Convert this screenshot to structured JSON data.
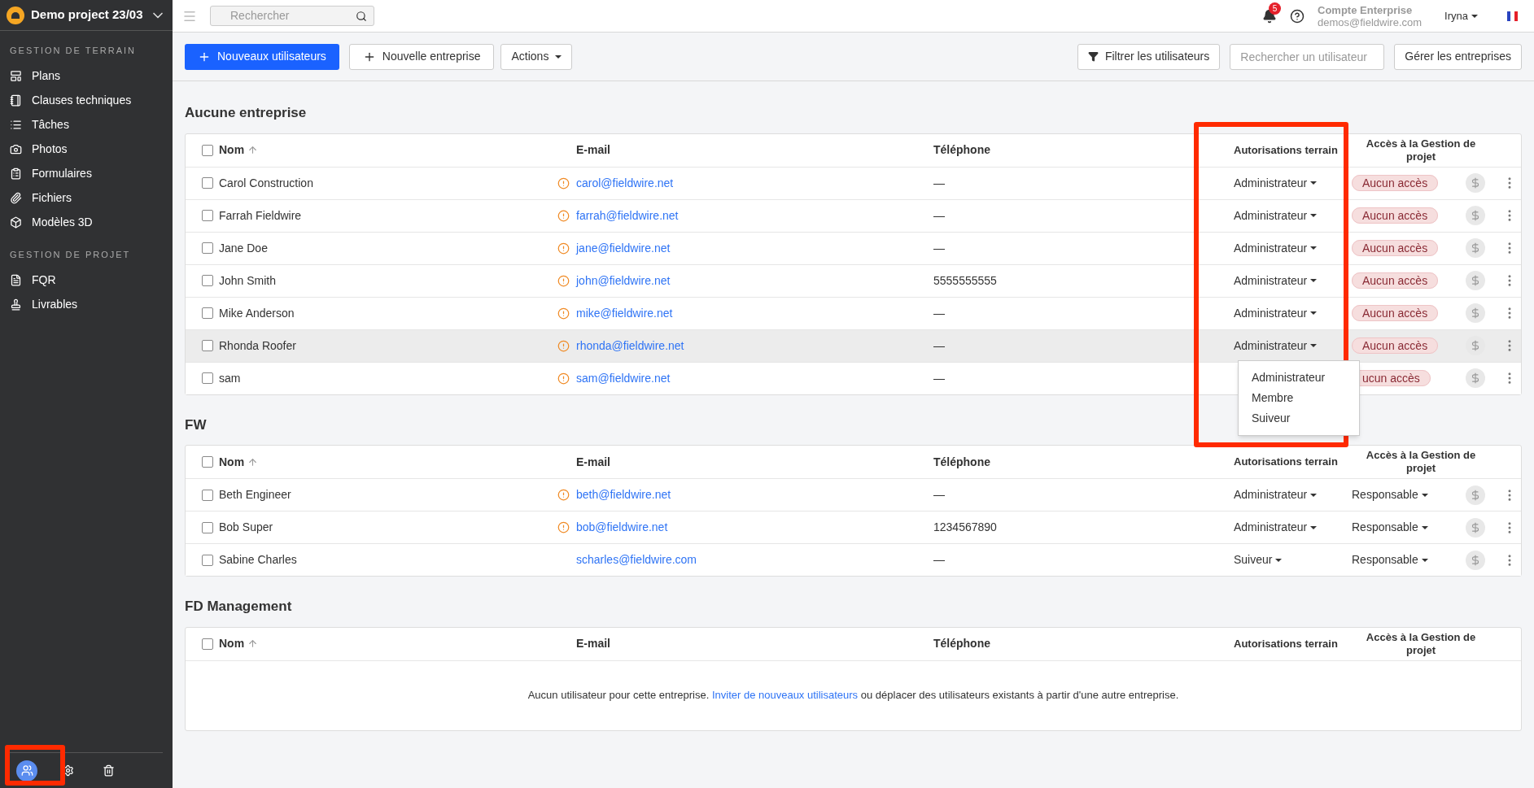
{
  "project": {
    "title": "Demo project 23/03"
  },
  "sidebar": {
    "sections": [
      {
        "heading": "GESTION DE TERRAIN",
        "items": [
          {
            "label": "Plans"
          },
          {
            "label": "Clauses techniques"
          },
          {
            "label": "Tâches"
          },
          {
            "label": "Photos"
          },
          {
            "label": "Formulaires"
          },
          {
            "label": "Fichiers"
          },
          {
            "label": "Modèles 3D"
          }
        ]
      },
      {
        "heading": "GESTION DE PROJET",
        "items": [
          {
            "label": "FQR"
          },
          {
            "label": "Livrables"
          }
        ]
      }
    ],
    "footer": [
      {
        "selected": true
      },
      {
        "selected": false
      },
      {
        "selected": false
      }
    ]
  },
  "topbar": {
    "search": {
      "placeholder": "Rechercher"
    },
    "notifications": "5",
    "account": {
      "title": "Compte Enterprise",
      "email": "demos@fieldwire.com"
    },
    "user": "Iryna"
  },
  "toolbar": {
    "primary": "Nouveaux utilisateurs",
    "new_company": "Nouvelle entreprise",
    "actions": "Actions",
    "filter": "Filtrer les utilisateurs",
    "user_search": {
      "placeholder": "Rechercher un utilisateur"
    },
    "manage": "Gérer les entreprises"
  },
  "groups": [
    {
      "title": "Aucune entreprise",
      "all_checked": false,
      "columns": [
        "Nom",
        "E-mail",
        "Téléphone",
        "Autorisations terrain",
        "Accès à la Gestion de projet"
      ],
      "rows": [
        {
          "name": "Carol Construction",
          "warning": true,
          "email": "carol@fieldwire.net",
          "phone": "—",
          "role": "Administrateur",
          "access": {
            "kind": "badge",
            "label": "Aucun accès"
          },
          "hovered": false
        },
        {
          "name": "Farrah Fieldwire",
          "warning": true,
          "email": "farrah@fieldwire.net",
          "phone": "—",
          "role": "Administrateur",
          "access": {
            "kind": "badge",
            "label": "Aucun accès"
          },
          "hovered": false
        },
        {
          "name": "Jane Doe",
          "warning": true,
          "email": "jane@fieldwire.net",
          "phone": "—",
          "role": "Administrateur",
          "access": {
            "kind": "badge",
            "label": "Aucun accès"
          },
          "hovered": false
        },
        {
          "name": "John Smith",
          "warning": true,
          "email": "john@fieldwire.net",
          "phone": "5555555555",
          "role": "Administrateur",
          "access": {
            "kind": "badge",
            "label": "Aucun accès"
          },
          "hovered": false
        },
        {
          "name": "Mike Anderson",
          "warning": true,
          "email": "mike@fieldwire.net",
          "phone": "—",
          "role": "Administrateur",
          "access": {
            "kind": "badge",
            "label": "Aucun accès"
          },
          "hovered": false
        },
        {
          "name": "Rhonda Roofer",
          "warning": true,
          "email": "rhonda@fieldwire.net",
          "phone": "—",
          "role": "Administrateur",
          "access": {
            "kind": "badge",
            "label": "Aucun accès"
          },
          "hovered": true,
          "role_menu": [
            "Administrateur",
            "Membre",
            "Suiveur"
          ]
        },
        {
          "name": "sam",
          "warning": true,
          "email": "sam@fieldwire.net",
          "phone": "—",
          "access": {
            "kind": "badge",
            "label": "ucun accès"
          },
          "hovered": false
        }
      ]
    },
    {
      "title": "FW",
      "all_checked": false,
      "columns": [
        "Nom",
        "E-mail",
        "Téléphone",
        "Autorisations terrain",
        "Accès à la Gestion de projet"
      ],
      "rows": [
        {
          "name": "Beth Engineer",
          "warning": true,
          "email": "beth@fieldwire.net",
          "phone": "—",
          "role": "Administrateur",
          "access": {
            "kind": "dropdown",
            "label": "Responsable"
          },
          "hovered": false
        },
        {
          "name": "Bob Super",
          "warning": true,
          "email": "bob@fieldwire.net",
          "phone": "1234567890",
          "role": "Administrateur",
          "access": {
            "kind": "dropdown",
            "label": "Responsable"
          },
          "hovered": false
        },
        {
          "name": "Sabine Charles",
          "warning": false,
          "email": "scharles@fieldwire.com",
          "phone": "—",
          "role": "Suiveur",
          "access": {
            "kind": "dropdown",
            "label": "Responsable"
          },
          "hovered": false
        }
      ]
    },
    {
      "title": "FD Management",
      "all_checked": false,
      "columns": [
        "Nom",
        "E-mail",
        "Téléphone",
        "Autorisations terrain",
        "Accès à la Gestion de projet"
      ],
      "empty": {
        "before": "Aucun utilisateur pour cette entreprise.",
        "link": "Inviter de nouveaux utilisateurs",
        "after": "ou déplacer des utilisateurs existants à partir d'une autre entreprise."
      }
    }
  ]
}
